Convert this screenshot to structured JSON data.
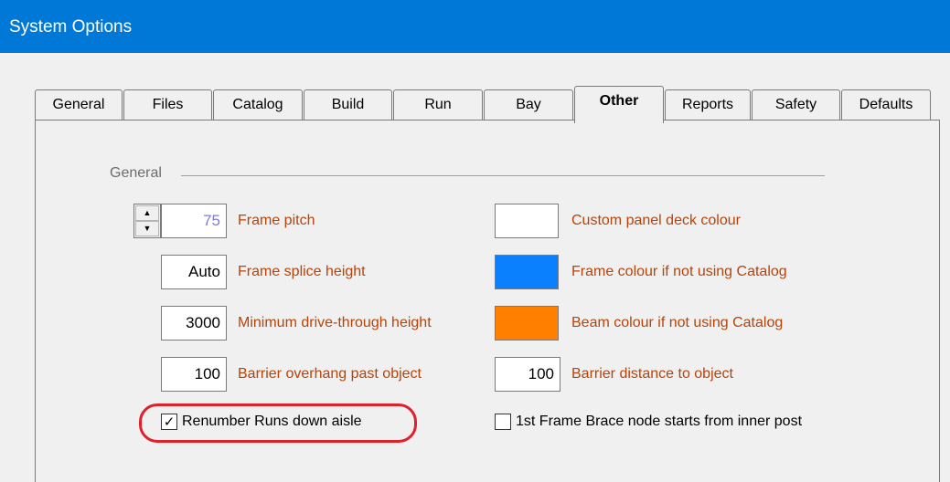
{
  "window": {
    "title": "System Options"
  },
  "tabs": [
    {
      "label": "General"
    },
    {
      "label": "Files"
    },
    {
      "label": "Catalog"
    },
    {
      "label": "Build"
    },
    {
      "label": "Run"
    },
    {
      "label": "Bay"
    },
    {
      "label": "Other"
    },
    {
      "label": "Reports"
    },
    {
      "label": "Safety"
    },
    {
      "label": "Defaults"
    }
  ],
  "active_tab": "Other",
  "group": {
    "label": "General"
  },
  "left_fields": [
    {
      "value": "75",
      "label": "Frame pitch"
    },
    {
      "value": "Auto",
      "label": "Frame splice height"
    },
    {
      "value": "3000",
      "label": "Minimum drive-through height"
    },
    {
      "value": "100",
      "label": "Barrier overhang past object"
    }
  ],
  "right_fields": [
    {
      "label": "Custom panel deck colour",
      "color": "#ffffff"
    },
    {
      "label": "Frame colour if not using Catalog",
      "color": "#0a80ff"
    },
    {
      "label": "Beam colour if not using Catalog",
      "color": "#ff8000"
    },
    {
      "value": "100",
      "label": "Barrier distance to object"
    }
  ],
  "checkboxes": [
    {
      "label": "Renumber Runs down aisle",
      "checked": true,
      "mark": "✓"
    },
    {
      "label": "1st Frame Brace node starts from inner post",
      "checked": false,
      "mark": ""
    }
  ],
  "annotation_color": "#e0202a"
}
